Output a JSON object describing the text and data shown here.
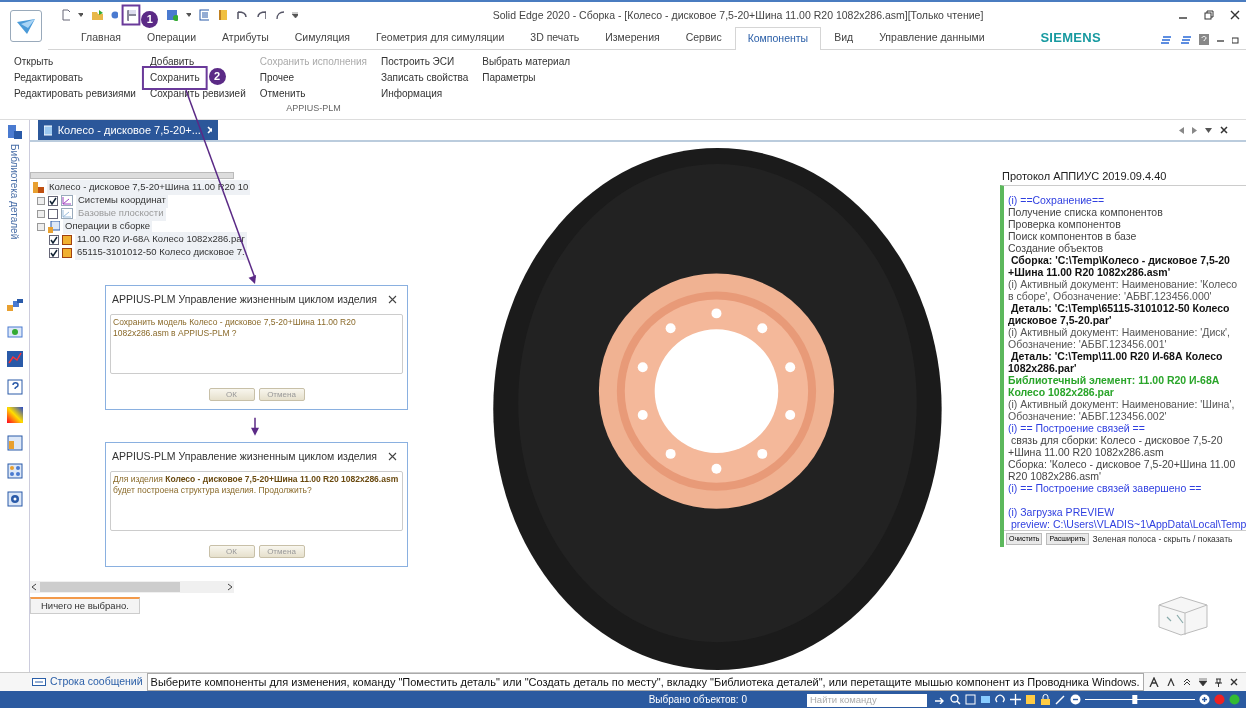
{
  "window": {
    "title": "Solid Edge 2020 - Сборка - [Колесо - дисковое 7,5-20+Шина 11.00 R20 1082x286.asm][Только чтение]"
  },
  "ribbon_tabs": [
    {
      "label": "Главная",
      "selected": false
    },
    {
      "label": "Операции",
      "selected": false
    },
    {
      "label": "Атрибуты",
      "selected": false
    },
    {
      "label": "Симуляция",
      "selected": false
    },
    {
      "label": "Геометрия для симуляции",
      "selected": false
    },
    {
      "label": "3D печать",
      "selected": false
    },
    {
      "label": "Измерения",
      "selected": false
    },
    {
      "label": "Сервис",
      "selected": false
    },
    {
      "label": "Компоненты",
      "selected": true
    },
    {
      "label": "Вид",
      "selected": false
    },
    {
      "label": "Управление данными",
      "selected": false
    }
  ],
  "brand": "SIEMENS",
  "ribbon": {
    "columns": [
      {
        "commands": [
          {
            "label": "Открыть",
            "disabled": false
          },
          {
            "label": "Редактировать",
            "disabled": false
          },
          {
            "label": "Редактировать ревизиями",
            "disabled": false
          }
        ]
      },
      {
        "commands": [
          {
            "label": "Добавить",
            "disabled": false
          },
          {
            "label": "Сохранить",
            "disabled": false
          },
          {
            "label": "Сохранить ревизией",
            "disabled": false
          }
        ]
      },
      {
        "commands": [
          {
            "label": "Сохранить исполнения",
            "disabled": true
          },
          {
            "label": "Прочее",
            "disabled": false
          },
          {
            "label": "Отменить",
            "disabled": false
          }
        ]
      },
      {
        "commands": [
          {
            "label": "Построить ЭСИ",
            "disabled": false
          },
          {
            "label": "Записать свойства",
            "disabled": false
          },
          {
            "label": "Информация",
            "disabled": false
          }
        ]
      },
      {
        "commands": [
          {
            "label": "Выбрать материал",
            "disabled": false
          },
          {
            "label": "Параметры",
            "disabled": false
          }
        ]
      }
    ],
    "group_label": "APPIUS-PLM"
  },
  "annotations": [
    {
      "label": "1"
    },
    {
      "label": "2"
    }
  ],
  "side_panel": {
    "label": "Библиотека деталей"
  },
  "document_tab": {
    "title": "Колесо - дисковое 7,5-20+..."
  },
  "tree": {
    "root": "Колесо - дисковое 7,5-20+Шина 11.00 R20 10",
    "items": [
      {
        "kind": "folder",
        "label": "Системы координат",
        "checked": true,
        "dimmed": false
      },
      {
        "kind": "folder",
        "label": "Базовые плоскости",
        "checked": false,
        "dimmed": true
      },
      {
        "kind": "operations",
        "label": "Операции в сборке",
        "dimmed": false
      },
      {
        "kind": "part",
        "label": "11.00 R20 И-68А Колесо 1082x286.par",
        "checked": true,
        "dimmed": false
      },
      {
        "kind": "part",
        "label": "65115-3101012-50 Колесо дисковое 7.",
        "checked": true,
        "dimmed": false
      }
    ]
  },
  "dialogs": [
    {
      "title": "APPIUS-PLM Управление жизненным циклом изделия",
      "message": "Сохранить модель Колесо - дисковое 7,5-20+Шина 11.00 R20 1082x286.asm в APPIUS-PLM ?",
      "buttons": [
        "ОК",
        "Отмена"
      ]
    },
    {
      "title": "APPIUS-PLM Управление жизненным циклом изделия",
      "message": "Для изделия **Колесо - дисковое 7,5-20+Шина 11.00 R20 1082x286.asm** будет построена структура изделия. Продолжить?",
      "buttons": [
        "ОК",
        "Отмена"
      ]
    }
  ],
  "selection_status": "Ничего не выбрано.",
  "protocol": {
    "title": "Протокол АППИУС 2019.09.4.40",
    "lines": [
      {
        "kind": "info",
        "text": "(i) ==Сохранение=="
      },
      {
        "kind": "plain",
        "text": "Получение списка компонентов"
      },
      {
        "kind": "plain",
        "text": "Проверка компонентов"
      },
      {
        "kind": "plain",
        "text": "Поиск компонентов в базе"
      },
      {
        "kind": "plain",
        "text": "Создание объектов"
      },
      {
        "kind": "bold",
        "text": " Сборка: 'C:\\Temp\\Колесо - дисковое 7,5-20 +Шина 11.00 R20 1082x286.asm'"
      },
      {
        "kind": "note",
        "text": "(i) Активный документ: Наименование: 'Колесо в сборе', Обозначение: 'АБВГ.123456.000'"
      },
      {
        "kind": "bold",
        "text": " Деталь: 'C:\\Temp\\65115-3101012-50 Колесо дисковое 7,5-20.par'"
      },
      {
        "kind": "note",
        "text": "(i) Активный документ: Наименование: 'Диск', Обозначение: 'АБВГ.123456.001'"
      },
      {
        "kind": "bold",
        "text": " Деталь: 'C:\\Temp\\11.00 R20 И-68А Колесо 1082x286.par'"
      },
      {
        "kind": "library",
        "text": "Библиотечный элемент: 11.00 R20 И-68А Колесо 1082x286.par"
      },
      {
        "kind": "note",
        "text": "(i) Активный документ: Наименование: 'Шина', Обозначение: 'АБВГ.123456.002'"
      },
      {
        "kind": "info",
        "text": "(i) == Построение связей =="
      },
      {
        "kind": "plain",
        "text": " связь для сборки: Колесо - дисковое 7,5-20 +Шина 11.00 R20 1082x286.asm"
      },
      {
        "kind": "plain",
        "text": "Сборка: 'Колесо - дисковое 7,5-20+Шина 11.00 R20 1082x286.asm'"
      },
      {
        "kind": "info",
        "text": "(i) == Построение связей завершено =="
      },
      {
        "kind": "info",
        "text": "(i) Загрузка PREVIEW"
      },
      {
        "kind": "info",
        "text": " preview: C:\\Users\\VLADIS~1\\AppData\\Local\\Temp"
      }
    ],
    "buttons": [
      "Очистить",
      "Расширить"
    ],
    "hint": "Зеленая полоса - скрыть / показать"
  },
  "message_bar": {
    "label": "Строка сообщений",
    "text": "Выберите компоненты для изменения, команду \"Поместить деталь\" или \"Создать деталь по месту\", вкладку \"Библиотека деталей\", или перетащите мышью компонент из Проводника Windows."
  },
  "status_bar": {
    "selected": "Выбрано объектов: 0",
    "command_placeholder": "Найти команду",
    "zoom": {
      "level": 0.45
    }
  }
}
